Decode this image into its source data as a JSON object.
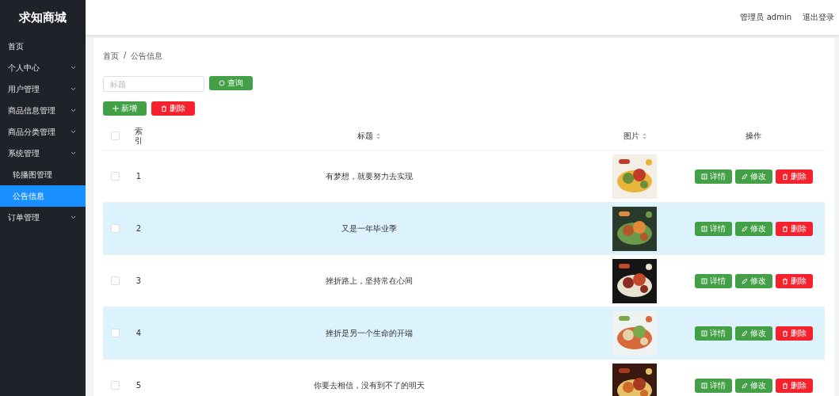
{
  "sidebar": {
    "brand": "求知商城",
    "items": [
      {
        "label": "首页",
        "expandable": false,
        "selected": false
      },
      {
        "label": "个人中心",
        "expandable": true,
        "expanded": false,
        "selected": false
      },
      {
        "label": "用户管理",
        "expandable": true,
        "expanded": false,
        "selected": false
      },
      {
        "label": "商品信息管理",
        "expandable": true,
        "expanded": false,
        "selected": false
      },
      {
        "label": "商品分类管理",
        "expandable": true,
        "expanded": false,
        "selected": false
      },
      {
        "label": "系统管理",
        "expandable": true,
        "expanded": true,
        "selected": false,
        "children": [
          {
            "label": "轮播图管理",
            "selected": false
          },
          {
            "label": "公告信息",
            "selected": true
          }
        ]
      },
      {
        "label": "订单管理",
        "expandable": true,
        "expanded": false,
        "selected": false
      }
    ]
  },
  "header": {
    "user": "管理员 admin",
    "logout": "退出登录"
  },
  "breadcrumb": {
    "items": [
      "首页",
      "公告信息"
    ],
    "separator": "/"
  },
  "search": {
    "placeholder": "标题",
    "button": "查询"
  },
  "actions": {
    "add": "新增",
    "delete": "删除"
  },
  "table": {
    "all_checked": false,
    "columns": [
      {
        "label": "索引",
        "sortable": false
      },
      {
        "label": "标题",
        "sortable": true
      },
      {
        "label": "图片",
        "sortable": true
      },
      {
        "label": "操作",
        "sortable": false
      }
    ],
    "rows": [
      {
        "index": "1",
        "title": "有梦想，就要努力去实现",
        "checked": false,
        "highlighted": false,
        "buttons": [
          "详情",
          "修改",
          "删除"
        ]
      },
      {
        "index": "2",
        "title": "又是一年毕业季",
        "checked": false,
        "highlighted": true,
        "buttons": [
          "详情",
          "修改",
          "删除"
        ]
      },
      {
        "index": "3",
        "title": "挫折路上，坚持常在心间",
        "checked": false,
        "highlighted": false,
        "buttons": [
          "详情",
          "修改",
          "删除"
        ]
      },
      {
        "index": "4",
        "title": "挫折是另一个生命的开端",
        "checked": false,
        "highlighted": true,
        "buttons": [
          "详情",
          "修改",
          "删除"
        ]
      },
      {
        "index": "5",
        "title": "你要去相信，没有到不了的明天",
        "checked": false,
        "highlighted": false,
        "buttons": [
          "详情",
          "修改",
          "删除"
        ]
      }
    ]
  }
}
